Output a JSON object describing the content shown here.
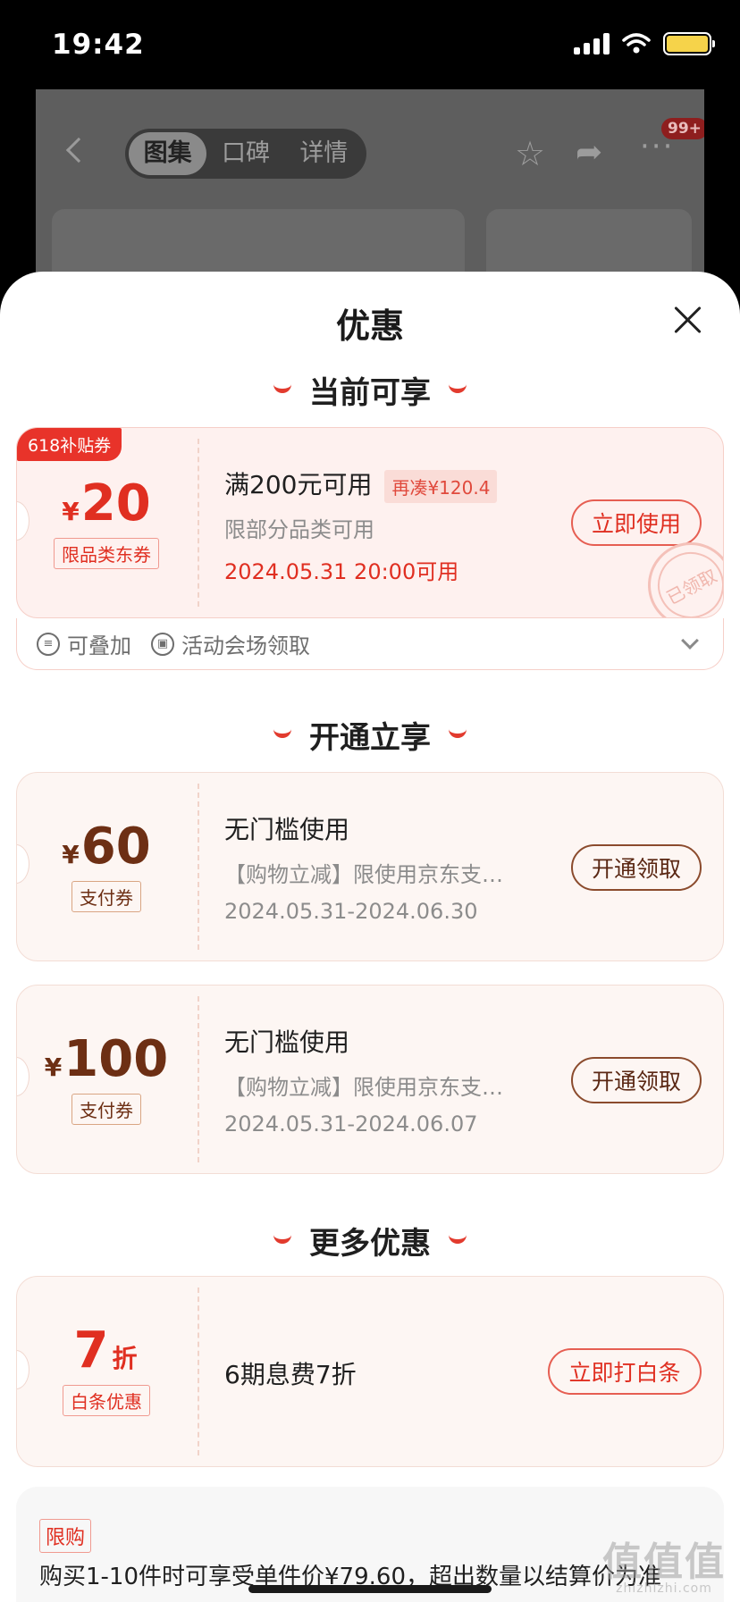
{
  "status_bar": {
    "time": "19:42"
  },
  "background_app": {
    "tabs": [
      "图集",
      "口碑",
      "详情"
    ],
    "active_tab": "图集",
    "more_badge": "99+"
  },
  "sheet": {
    "title": "优惠",
    "sections": {
      "current": "当前可享",
      "open": "开通立享",
      "more": "更多优惠"
    }
  },
  "coupon1": {
    "corner_tag": "618补贴券",
    "currency": "¥",
    "amount": "20",
    "type": "限品类东券",
    "title": "满200元可用",
    "need_badge": "再凑¥120.4",
    "subtitle": "限部分品类可用",
    "date": "2024.05.31 20:00可用",
    "button": "立即使用",
    "stamp": "已领取",
    "features": [
      "可叠加",
      "活动会场领取"
    ]
  },
  "coupon2": {
    "currency": "¥",
    "amount": "60",
    "type": "支付券",
    "title": "无门槛使用",
    "subtitle": "【购物立减】限使用京东支…",
    "date": "2024.05.31-2024.06.30",
    "button": "开通领取"
  },
  "coupon3": {
    "currency": "¥",
    "amount": "100",
    "type": "支付券",
    "title": "无门槛使用",
    "subtitle": "【购物立减】限使用京东支…",
    "date": "2024.05.31-2024.06.07",
    "button": "开通领取"
  },
  "coupon4": {
    "amount": "7",
    "unit": "折",
    "type": "白条优惠",
    "title": "6期息费7折",
    "button": "立即打白条"
  },
  "limit": {
    "tag": "限购",
    "text": "购买1-10件时可享受单件价¥79.60，超出数量以结算价为准"
  },
  "watermark": {
    "big": "值值值",
    "small": "zhizhizhi.com"
  },
  "colors": {
    "accent_red": "#e02f21",
    "brown": "#6d2f14",
    "coupon_bg": "#fdf6f3"
  }
}
